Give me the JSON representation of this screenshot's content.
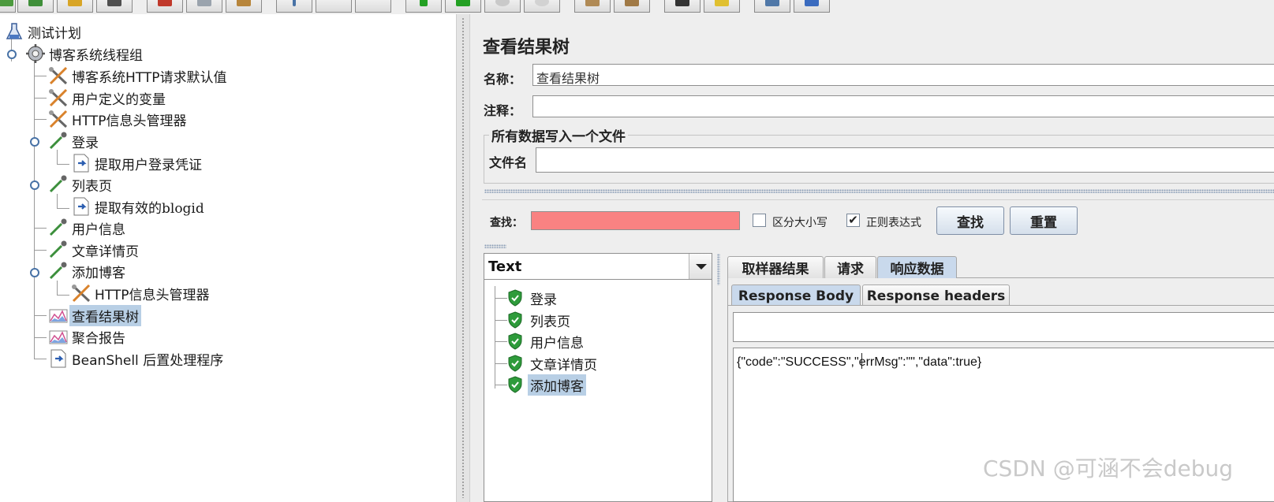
{
  "toolbar": {
    "buttons": [
      {
        "icon": "new-icon",
        "color": "#4c9a3e"
      },
      {
        "icon": "templates-icon",
        "color": "#3f8f3a"
      },
      {
        "icon": "open-icon",
        "color": "#d8a526"
      },
      {
        "icon": "save-icon",
        "color": "#505050"
      },
      {
        "icon": "cut-icon",
        "color": "#c0392b"
      },
      {
        "icon": "copy-icon",
        "color": "#9aa3ad"
      },
      {
        "icon": "paste-icon",
        "color": "#b7853b"
      },
      {
        "icon": "expand-icon",
        "color": "#4872a6"
      },
      {
        "icon": "collapse-icon",
        "color": "#b0b0b0"
      },
      {
        "icon": "toggle-icon",
        "color": "#b0b0b0"
      },
      {
        "icon": "start-icon",
        "color": "#23a023"
      },
      {
        "icon": "start-no-pause-icon",
        "color": "#23a023"
      },
      {
        "icon": "stop-icon",
        "color": "#c0c0c0"
      },
      {
        "icon": "shutdown-icon",
        "color": "#c0c0c0"
      },
      {
        "icon": "clear-icon",
        "color": "#b08a55"
      },
      {
        "icon": "clear-all-icon",
        "color": "#a07945"
      },
      {
        "icon": "search-icon",
        "color": "#333333"
      },
      {
        "icon": "reset-search-icon",
        "color": "#e0c030"
      },
      {
        "icon": "function-helper-icon",
        "color": "#5078a8"
      },
      {
        "icon": "help-icon",
        "color": "#3a6bbf"
      }
    ]
  },
  "tree": {
    "nodes": [
      {
        "label": "测试计划",
        "icon": "flask-icon"
      },
      {
        "label": "博客系统线程组",
        "icon": "gear-icon"
      },
      {
        "label": "博客系统HTTP请求默认值",
        "icon": "wrench-icon"
      },
      {
        "label": "用户定义的变量",
        "icon": "wrench-icon"
      },
      {
        "label": "HTTP信息头管理器",
        "icon": "wrench-icon"
      },
      {
        "label": "登录",
        "icon": "pipette-icon"
      },
      {
        "label": "提取用户登录凭证",
        "icon": "postprocessor-icon"
      },
      {
        "label": "列表页",
        "icon": "pipette-icon"
      },
      {
        "label": "提取有效的blogid",
        "icon": "postprocessor-icon"
      },
      {
        "label": "用户信息",
        "icon": "pipette-icon"
      },
      {
        "label": "文章详情页",
        "icon": "pipette-icon"
      },
      {
        "label": "添加博客",
        "icon": "pipette-icon"
      },
      {
        "label": "HTTP信息头管理器",
        "icon": "wrench-icon"
      },
      {
        "label": "查看结果树",
        "icon": "graph-icon"
      },
      {
        "label": "聚合报告",
        "icon": "graph-icon"
      },
      {
        "label": "BeanShell 后置处理程序",
        "icon": "postprocessor-icon"
      }
    ]
  },
  "panel": {
    "title": "查看结果树",
    "name_label": "名称：",
    "name_value": "查看结果树",
    "comment_label": "注释：",
    "comment_value": "",
    "group_title": "所有数据写入一个文件",
    "filename_label": "文件名",
    "filename_value": ""
  },
  "search": {
    "label": "查找：",
    "value": "",
    "case_label": "区分大小写",
    "case_checked": false,
    "regex_label": "正则表达式",
    "regex_checked": true,
    "check_mark": "✔",
    "find_button": "查找",
    "reset_button": "重置"
  },
  "renderer": {
    "selected": "Text"
  },
  "results": {
    "items": [
      {
        "label": "登录",
        "status": "success"
      },
      {
        "label": "列表页",
        "status": "success"
      },
      {
        "label": "用户信息",
        "status": "success"
      },
      {
        "label": "文章详情页",
        "status": "success"
      },
      {
        "label": "添加博客",
        "status": "success"
      }
    ]
  },
  "tabs": {
    "main": [
      "取样器结果",
      "请求",
      "响应数据"
    ],
    "sub": [
      "Response Body",
      "Response headers"
    ]
  },
  "response": {
    "body": "{\"code\":\"SUCCESS\",\"errMsg\":\"\",\"data\":true}"
  },
  "watermark": "CSDN @可涵不会debug",
  "colors": {
    "selection": "#b8cfe5",
    "search_error": "#f98282",
    "success": "#2e9b3b"
  }
}
